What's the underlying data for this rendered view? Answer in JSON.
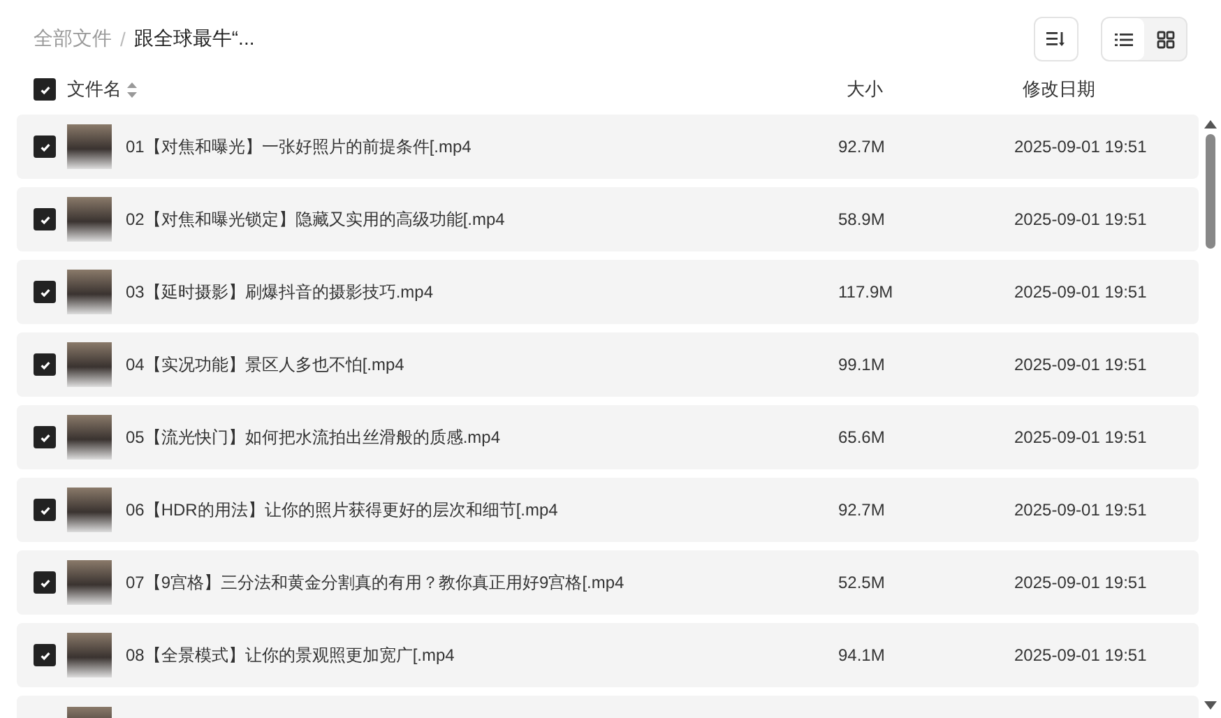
{
  "breadcrumb": [
    {
      "label": "全部文件",
      "current": false
    },
    {
      "label": "跟全球最牛“...",
      "current": true
    }
  ],
  "breadcrumb_separator": "/",
  "view_modes": [
    {
      "kind": "list",
      "selected": true
    },
    {
      "kind": "grid",
      "selected": false
    }
  ],
  "header": {
    "checked": true,
    "columns": [
      "文件名",
      "大小",
      "修改日期"
    ]
  },
  "rows": [
    {
      "kind": "file",
      "checked": true,
      "name": "01【对焦和曝光】一张好照片的前提条件[.mp4",
      "size": "92.7M",
      "date": "2025-09-01 19:51"
    },
    {
      "kind": "file",
      "checked": true,
      "name": "02【对焦和曝光锁定】隐藏又实用的高级功能[.mp4",
      "size": "58.9M",
      "date": "2025-09-01 19:51"
    },
    {
      "kind": "file",
      "checked": true,
      "name": "03【延时摄影】刷爆抖音的摄影技巧.mp4",
      "size": "117.9M",
      "date": "2025-09-01 19:51"
    },
    {
      "kind": "file",
      "checked": true,
      "name": "04【实况功能】景区人多也不怕[.mp4",
      "size": "99.1M",
      "date": "2025-09-01 19:51"
    },
    {
      "kind": "file",
      "checked": true,
      "name": "05【流光快门】如何把水流拍出丝滑般的质感.mp4",
      "size": "65.6M",
      "date": "2025-09-01 19:51"
    },
    {
      "kind": "file",
      "checked": true,
      "name": "06【HDR的用法】让你的照片获得更好的层次和细节[.mp4",
      "size": "92.7M",
      "date": "2025-09-01 19:51"
    },
    {
      "kind": "file",
      "checked": true,
      "name": "07【9宫格】三分法和黄金分割真的有用？教你真正用好9宫格[.mp4",
      "size": "52.5M",
      "date": "2025-09-01 19:51"
    },
    {
      "kind": "file",
      "checked": true,
      "name": "08【全景模式】让你的景观照更加宽广[.mp4",
      "size": "94.1M",
      "date": "2025-09-01 19:51"
    },
    {
      "kind": "partial"
    }
  ]
}
